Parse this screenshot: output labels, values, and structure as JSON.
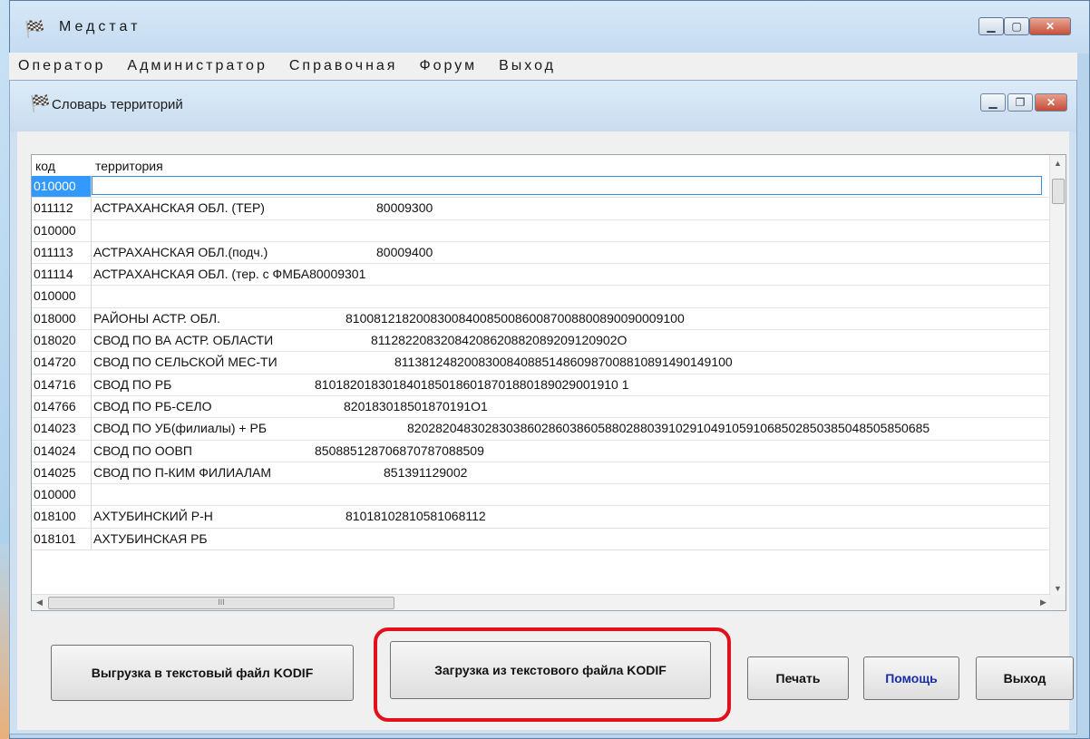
{
  "app": {
    "title": "Медстат"
  },
  "menu": [
    "Оператор",
    "Администратор",
    "Справочная",
    "Форум",
    "Выход"
  ],
  "window": {
    "title": "Словарь территорий"
  },
  "grid": {
    "columns": [
      "код",
      "территория"
    ],
    "rows": [
      {
        "code": "010000",
        "name": "",
        "num": ""
      },
      {
        "code": "011112",
        "name": "АСТРАХАНСКАЯ ОБЛ. (ТЕР)",
        "num": "80009300"
      },
      {
        "code": "010000",
        "name": "",
        "num": ""
      },
      {
        "code": "011113",
        "name": "АСТРАХАНСКАЯ ОБЛ.(подч.)",
        "num": "80009400"
      },
      {
        "code": "011114",
        "name": "АСТРАХАНСКАЯ ОБЛ. (тер. с ФМБА80009301",
        "num": ""
      },
      {
        "code": "010000",
        "name": "",
        "num": ""
      },
      {
        "code": "018000",
        "name": "РАЙОНЫ АСТР. ОБЛ.",
        "num": "810081218200830084008500860087008800890090009100"
      },
      {
        "code": "018020",
        "name": "СВОД ПО ВА АСТР. ОБЛАСТИ",
        "num": "81128220832084208620882089209120902O"
      },
      {
        "code": "014720",
        "name": "СВОД ПО СЕЛЬСКОЙ МЕС-ТИ",
        "num": "811381248200830084088514860987008810891490149100"
      },
      {
        "code": "014716",
        "name": "СВОД ПО РБ",
        "num": "8101820183018401850186018701880189029001910 1"
      },
      {
        "code": "014766",
        "name": "СВОД ПО РБ-СЕЛО",
        "num": "820183018501870191O1"
      },
      {
        "code": "014023",
        "name": "СВОД ПО УБ(филиалы) + РБ",
        "num": "8202820483028303860286038605880288039102910491059106850285038504850585068​5"
      },
      {
        "code": "014024",
        "name": "СВОД ПО ООВП",
        "num": "850885128706870787088509"
      },
      {
        "code": "014025",
        "name": "СВОД ПО П-КИМ ФИЛИАЛАМ",
        "num": "851391129002"
      },
      {
        "code": "010000",
        "name": "",
        "num": ""
      },
      {
        "code": "018100",
        "name": "АХТУБИНСКИЙ Р-Н",
        "num": "81018102810581068112"
      },
      {
        "code": "018101",
        "name": "АХТУБИНСКАЯ РБ",
        "num": ""
      }
    ],
    "scroll_thumb_label": "III"
  },
  "buttons": {
    "export": "Выгрузка в текстовый файл  KODIF",
    "import": "Загрузка из текстового  файла  KODIF",
    "print": "Печать",
    "help": "Помощь",
    "exit": "Выход"
  },
  "colors": {
    "highlight": "#e2101a",
    "selection": "#3399ff",
    "help_text": "#1a2ea8"
  }
}
